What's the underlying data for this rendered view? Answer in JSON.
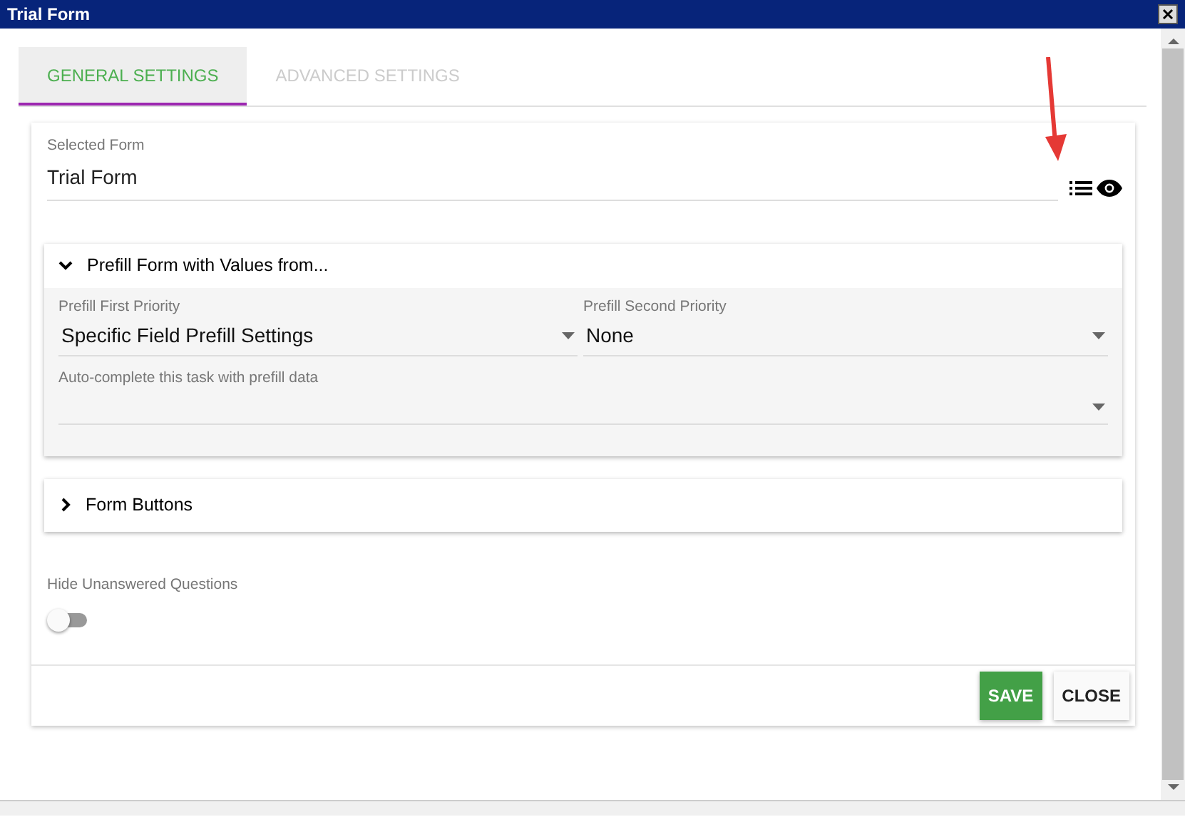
{
  "window": {
    "title": "Trial Form"
  },
  "tabs": [
    {
      "label": "GENERAL SETTINGS",
      "selected": true
    },
    {
      "label": "ADVANCED SETTINGS",
      "selected": false
    }
  ],
  "selected_form": {
    "label": "Selected Form",
    "value": "Trial Form"
  },
  "panels": [
    {
      "title": "Prefill Form with Values from...",
      "expanded": true,
      "fields": [
        {
          "label": "Prefill First Priority",
          "value": "Specific Field Prefill Settings"
        },
        {
          "label": "Prefill Second Priority",
          "value": "None"
        },
        {
          "label": "Auto-complete this task with prefill data"
        }
      ]
    },
    {
      "title": "Form Buttons",
      "expanded": false
    }
  ],
  "hide_unanswered": {
    "label": "Hide Unanswered Questions",
    "on": false
  },
  "buttons": [
    {
      "label": "SAVE",
      "kind": "primary"
    },
    {
      "label": "CLOSE",
      "kind": "plain"
    }
  ]
}
